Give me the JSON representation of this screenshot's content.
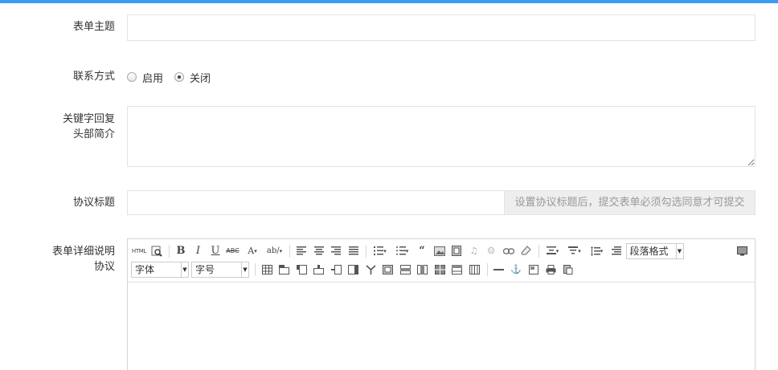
{
  "colors": {
    "accent": "#3a9bf2",
    "border": "#e3e3e3",
    "addon_bg": "#eeeeee"
  },
  "form": {
    "subject": {
      "label": "表单主题",
      "value": ""
    },
    "contact": {
      "label": "联系方式",
      "options": [
        "启用",
        "关闭"
      ],
      "selected": "关闭"
    },
    "keyword_reply": {
      "label_line1": "关键字回复",
      "label_line2": "头部简介",
      "value": ""
    },
    "agreement_title": {
      "label": "协议标题",
      "value": "",
      "addon": "设置协议标题后，提交表单必须勾选同意才可提交"
    },
    "detail": {
      "label_line1": "表单详细说明",
      "label_line2": "协议"
    }
  },
  "editor": {
    "html_label": "HTML",
    "paragraph_format": "段落格式",
    "font_family": "字体",
    "font_size": "字号",
    "row1_icons": [
      "html-icon",
      "preview-icon",
      "bold-icon",
      "italic-icon",
      "underline-icon",
      "strikethrough-icon",
      "font-color-icon",
      "highlight-icon",
      "align-left-icon",
      "align-center-icon",
      "align-right-icon",
      "align-justify-icon",
      "ordered-list-icon",
      "unordered-list-icon",
      "blockquote-icon",
      "image-icon",
      "video-icon",
      "music-icon",
      "emotion-icon",
      "link-icon",
      "eraser-icon",
      "paragraph-spacing-icon",
      "indent-icon",
      "line-height-icon",
      "format-icon",
      "fullscreen-icon"
    ],
    "row2_icons": [
      "table-icon",
      "insert-row-icon",
      "insert-col-icon",
      "merge-cells-icon",
      "split-cells-icon",
      "delete-row-icon",
      "delete-col-icon",
      "table-layout-icon",
      "table-cell-icon",
      "table-col-icon",
      "table-row-icon",
      "table-grid-icon",
      "table-delete-icon",
      "horizontal-rule-icon",
      "anchor-icon",
      "template-icon",
      "print-icon",
      "paste-icon"
    ]
  }
}
